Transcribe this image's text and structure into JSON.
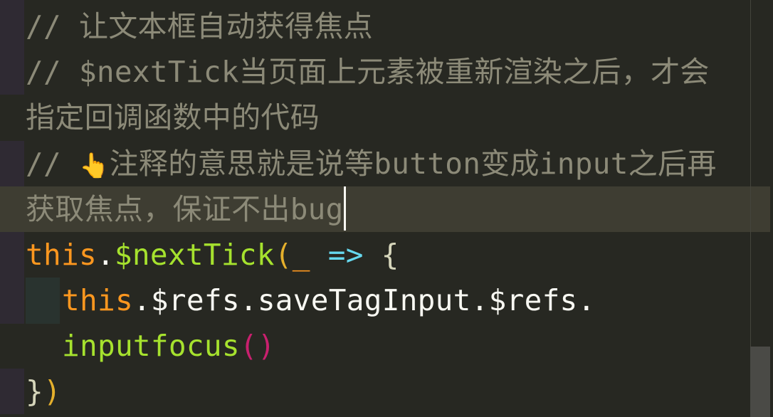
{
  "editor": {
    "colors": {
      "background": "#272822",
      "comment": "#8c8a78",
      "keyword": "#fd971f",
      "function": "#a6e22e",
      "plain": "#f8f8f2",
      "arrow": "#66d9ef",
      "paren": "#e5b02c",
      "call_paren": "#c9206e"
    },
    "lines": [
      {
        "comment": "// 让文本框自动获得焦点"
      },
      {
        "comment": "// $nextTick当页面上元素被重新渲染之后，才会"
      },
      {
        "comment": "指定回调函数中的代码"
      },
      {
        "comment_prefix": "// ",
        "emoji": "👆",
        "comment": "注释的意思就是说等button变成input之后再"
      },
      {
        "comment": "获取焦点，保证不出bug"
      },
      {
        "t1": "this",
        "t2": ".",
        "t3": "$nextTick",
        "t4": "(",
        "t5": "_",
        "t6": " ",
        "t7": "=>",
        "t8": " {"
      },
      {
        "t1": "this",
        "t2": ".$refs.saveTagInput.$refs."
      },
      {
        "t1": "inputfocus",
        "t2": "()"
      },
      {
        "t1": "}",
        "t2": ")"
      }
    ]
  }
}
